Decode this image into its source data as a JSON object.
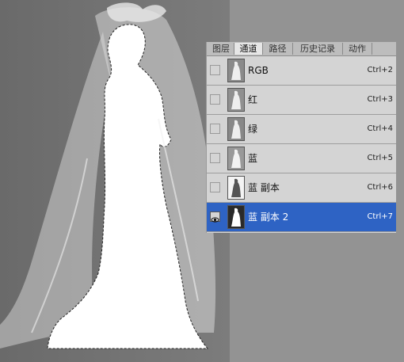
{
  "panel": {
    "tabs": [
      "图层",
      "通道",
      "路径",
      "历史记录",
      "动作"
    ],
    "active_tab": 1,
    "channels": [
      {
        "label": "RGB",
        "shortcut": "Ctrl+2",
        "thumb": "gray",
        "visible": false,
        "selected": false
      },
      {
        "label": "红",
        "shortcut": "Ctrl+3",
        "thumb": "gray",
        "visible": false,
        "selected": false
      },
      {
        "label": "绿",
        "shortcut": "Ctrl+4",
        "thumb": "gray",
        "visible": false,
        "selected": false
      },
      {
        "label": "蓝",
        "shortcut": "Ctrl+5",
        "thumb": "gray",
        "visible": false,
        "selected": false
      },
      {
        "label": "蓝 副本",
        "shortcut": "Ctrl+6",
        "thumb": "light",
        "visible": false,
        "selected": false
      },
      {
        "label": "蓝 副本 2",
        "shortcut": "Ctrl+7",
        "thumb": "mask",
        "visible": true,
        "selected": true
      }
    ]
  },
  "colors": {
    "canvas_left": "#6c6c6c",
    "canvas_right": "#8a8a8a",
    "selection": "#2e63c4",
    "panel_bg": "#d4d4d4"
  },
  "icons": {
    "eye": "eye-icon",
    "thumbnail": "channel-thumbnail-icon"
  }
}
